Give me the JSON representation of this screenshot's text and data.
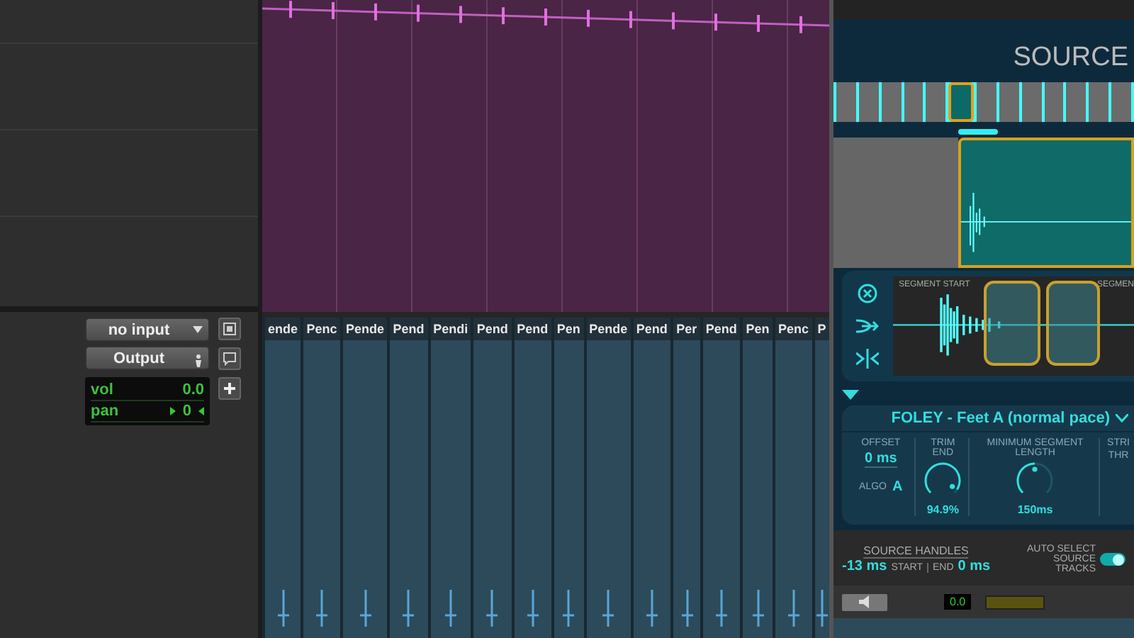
{
  "track_controls": {
    "input": "no input",
    "output": "Output",
    "vol_label": "vol",
    "vol": "0.0",
    "pan_label": "pan",
    "pan": "0"
  },
  "clips": [
    {
      "label": "ende"
    },
    {
      "label": "Penc"
    },
    {
      "label": "Pende"
    },
    {
      "label": "Pend"
    },
    {
      "label": "Pendi"
    },
    {
      "label": "Pend"
    },
    {
      "label": "Pend"
    },
    {
      "label": "Pen"
    },
    {
      "label": "Pende"
    },
    {
      "label": "Pend"
    },
    {
      "label": "Per"
    },
    {
      "label": "Pend"
    },
    {
      "label": "Pen"
    },
    {
      "label": "Penc"
    },
    {
      "label": "P"
    }
  ],
  "plugin": {
    "title": "SOURCE",
    "frames": [
      {
        "selected": false
      },
      {
        "selected": false
      },
      {
        "selected": false
      },
      {
        "selected": false
      },
      {
        "selected": false
      },
      {
        "selected": true
      },
      {
        "selected": false
      },
      {
        "selected": false
      },
      {
        "selected": false
      },
      {
        "selected": false
      },
      {
        "selected": false
      },
      {
        "selected": false
      },
      {
        "selected": false
      }
    ],
    "segment_start": "SEGMENT START",
    "segment_end": "SEGMEN",
    "preset": "FOLEY - Feet A (normal pace)",
    "offset": {
      "label": "OFFSET",
      "value": "0 ms"
    },
    "algo": {
      "label": "ALGO",
      "value": "A"
    },
    "params": [
      {
        "kind": "knob",
        "label": "TRIM END",
        "value": "94.9%",
        "level": 0.95
      },
      {
        "kind": "knob",
        "label": "MINIMUM SEGMENT LENGTH",
        "value": "150ms",
        "level": 0.5
      },
      {
        "kind": "cut",
        "label": "STRI",
        "sub": "THR"
      }
    ],
    "handles": {
      "title": "SOURCE HANDLES",
      "start_value": "-13 ms",
      "start_label": "START",
      "end_label": "END",
      "end_value": "0 ms"
    },
    "auto_select": {
      "label": "AUTO SELECT SOURCE TRACKS",
      "on": true
    },
    "meter_value": "0.0"
  }
}
